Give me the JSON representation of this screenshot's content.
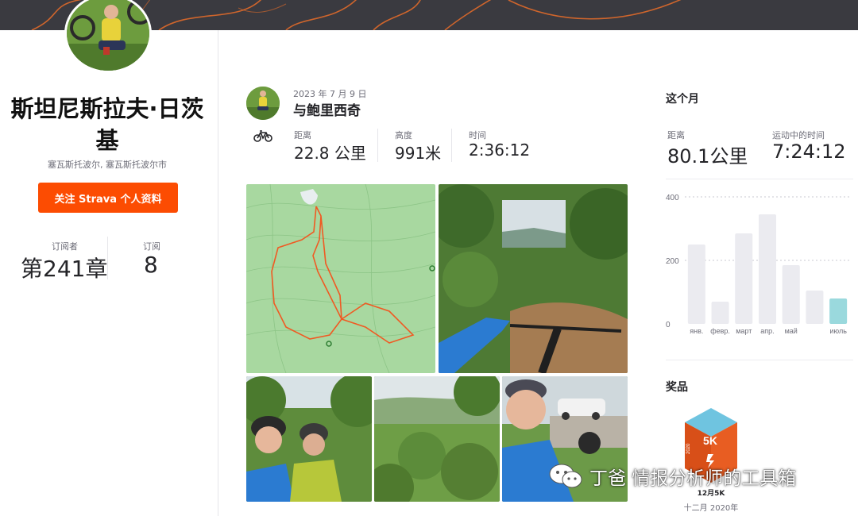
{
  "profile": {
    "name": "斯坦尼斯拉夫·日茨基",
    "location": "塞瓦斯托波尔, 塞瓦斯托波尔市",
    "follow_label": "关注 Strava 个人资料",
    "followers_label": "订阅者",
    "followers_value": "第241章",
    "following_label": "订阅",
    "following_value": "8"
  },
  "activity": {
    "date": "2023 年 7 月 9 日",
    "title": "与鲍里西奇",
    "type_icon": "bicycle-icon",
    "metrics": [
      {
        "label": "距离",
        "value": "22.8 公里"
      },
      {
        "label": "高度",
        "value": "991米"
      },
      {
        "label": "时间",
        "value": "2:36:12"
      }
    ]
  },
  "this_month": {
    "title": "这个月",
    "distance_label": "距离",
    "distance_value": "80.1公里",
    "moving_time_label": "运动中的时间",
    "moving_time_value": "7:24:12"
  },
  "chart_data": {
    "type": "bar",
    "categories": [
      "янв.",
      "февр.",
      "март",
      "апр.",
      "май",
      "",
      "июль"
    ],
    "values": [
      250,
      70,
      285,
      345,
      185,
      105,
      80
    ],
    "ylim": [
      0,
      400
    ],
    "yticks": [
      "400",
      "200",
      "0"
    ],
    "highlight_index": 6,
    "colors": {
      "bar": "#ebebf0",
      "highlight": "#9ad9dd",
      "grid": "#c8c8d0"
    }
  },
  "awards": {
    "title": "奖品",
    "trophy_badge_text": "5K",
    "trophy_year": "2020",
    "trophy_name": "12月5K",
    "trophy_date": "十二月 2020年"
  },
  "watermark": {
    "text": "丁爸 情报分析师的工具箱"
  },
  "colors": {
    "accent": "#fc4c02",
    "topbar": "#3a3a40",
    "trophy": "#e85d22",
    "trophy_top": "#6fc4e0"
  }
}
